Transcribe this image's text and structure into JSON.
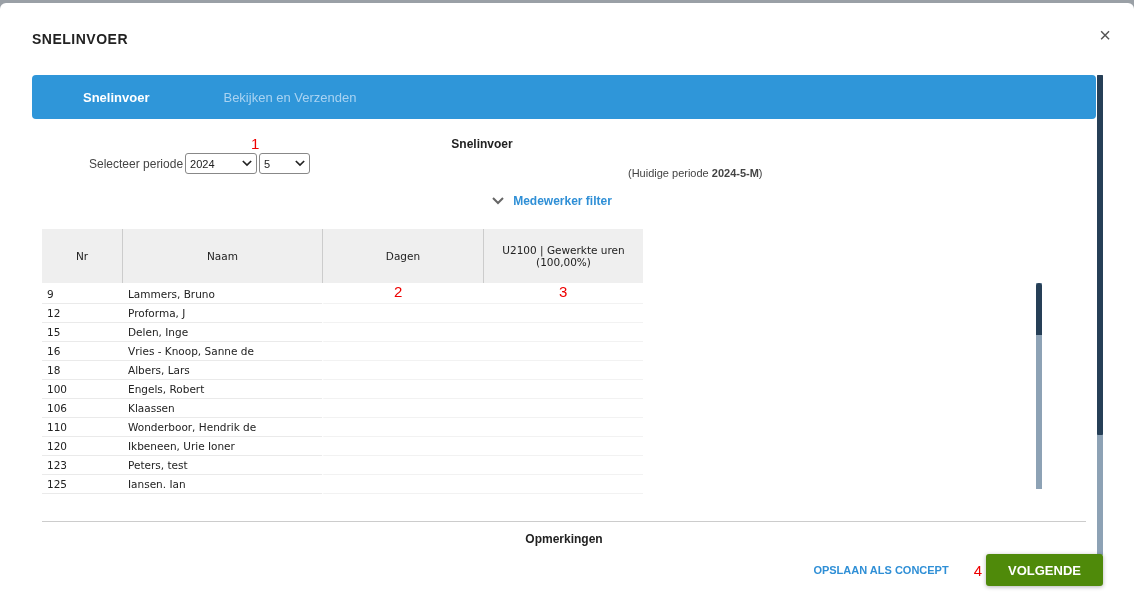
{
  "dialog": {
    "title": "SNELINVOER",
    "close": "×"
  },
  "tabs": [
    {
      "label": "Snelinvoer",
      "selected": true
    },
    {
      "label": "Bekijken en Verzenden",
      "selected": false
    }
  ],
  "heading": "Snelinvoer",
  "period": {
    "label": "Selecteer periode",
    "year": "2024",
    "month": "5",
    "marker": "1",
    "current": "(Huidige periode **2024-5-M**)"
  },
  "filter": {
    "label": "Medewerker filter",
    "expanded": false
  },
  "table": {
    "columns": [
      {
        "label": "Nr"
      },
      {
        "label": "Naam"
      },
      {
        "label": "Dagen",
        "marker": "2"
      },
      {
        "label": "U2100 | Gewerkte uren (100,00%)",
        "marker": "3"
      }
    ],
    "rows": [
      [
        "9",
        "Lammers, Bruno"
      ],
      [
        "12",
        "Proforma, J"
      ],
      [
        "15",
        "Delen, Inge"
      ],
      [
        "16",
        "Vries - Knoop, Sanne de"
      ],
      [
        "18",
        "Albers, Lars"
      ],
      [
        "100",
        "Engels, Robert"
      ],
      [
        "106",
        "Klaassen"
      ],
      [
        "110",
        "Wonderboor, Hendrik de"
      ],
      [
        "120",
        "Ikbeneen, Urie Ioner"
      ],
      [
        "123",
        "Peters, test"
      ],
      [
        "125",
        "Iansen. Ian"
      ]
    ]
  },
  "remarks": "Opmerkingen",
  "footer": {
    "save": "OPSLAAN ALS CONCEPT",
    "marker": "4",
    "next": "VOLGENDE"
  }
}
